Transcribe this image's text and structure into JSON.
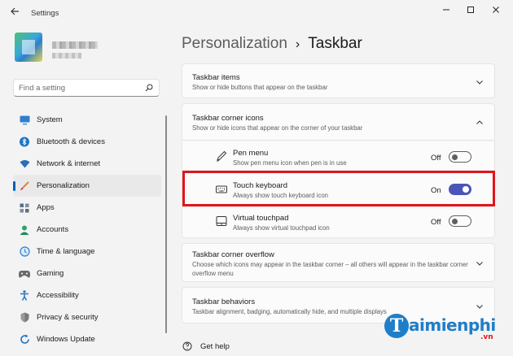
{
  "window": {
    "title": "Settings",
    "back_icon": "arrow-left-icon",
    "controls": [
      "minimize-icon",
      "maximize-icon",
      "close-icon"
    ]
  },
  "search": {
    "placeholder": "Find a setting",
    "icon": "search-icon"
  },
  "sidebar": {
    "items": [
      {
        "label": "System",
        "icon": "monitor-icon",
        "color": "#2f7fd0"
      },
      {
        "label": "Bluetooth & devices",
        "icon": "bluetooth-icon",
        "color": "#1e73c9"
      },
      {
        "label": "Network & internet",
        "icon": "wifi-icon",
        "color": "#2a6fb6"
      },
      {
        "label": "Personalization",
        "icon": "brush-icon",
        "color": "#e08a2c",
        "active": true
      },
      {
        "label": "Apps",
        "icon": "apps-icon",
        "color": "#5a6f86"
      },
      {
        "label": "Accounts",
        "icon": "person-icon",
        "color": "#2aa36b"
      },
      {
        "label": "Time & language",
        "icon": "globe-clock-icon",
        "color": "#2c7ed6"
      },
      {
        "label": "Gaming",
        "icon": "gamepad-icon",
        "color": "#6a6a6a"
      },
      {
        "label": "Accessibility",
        "icon": "accessibility-icon",
        "color": "#2b75c7"
      },
      {
        "label": "Privacy & security",
        "icon": "shield-icon",
        "color": "#7a7a7a"
      },
      {
        "label": "Windows Update",
        "icon": "update-icon",
        "color": "#1f72c4"
      }
    ]
  },
  "breadcrumb": {
    "parent": "Personalization",
    "separator": "›",
    "current": "Taskbar"
  },
  "sections": {
    "taskbar_items": {
      "title": "Taskbar items",
      "desc": "Show or hide buttons that appear on the taskbar",
      "expanded": false
    },
    "corner_icons": {
      "title": "Taskbar corner icons",
      "desc": "Show or hide icons that appear on the corner of your taskbar",
      "expanded": true,
      "items": [
        {
          "title": "Pen menu",
          "desc": "Show pen menu icon when pen is in use",
          "state": "Off",
          "icon": "pen-icon"
        },
        {
          "title": "Touch keyboard",
          "desc": "Always show touch keyboard icon",
          "state": "On",
          "icon": "keyboard-icon"
        },
        {
          "title": "Virtual touchpad",
          "desc": "Always show virtual touchpad icon",
          "state": "Off",
          "icon": "touchpad-icon"
        }
      ]
    },
    "corner_overflow": {
      "title": "Taskbar corner overflow",
      "desc": "Choose which icons may appear in the taskbar corner – all others will appear in the taskbar corner overflow menu",
      "expanded": false
    },
    "behaviors": {
      "title": "Taskbar behaviors",
      "desc": "Taskbar alignment, badging, automatically hide, and multiple displays",
      "expanded": false
    }
  },
  "help": {
    "label": "Get help",
    "icon": "help-icon"
  },
  "watermark": {
    "brand": "aimienphi",
    "initial": "T",
    "tld": ".vn",
    "color": "#1f7ec8"
  },
  "highlight_color": "#e0161b",
  "accent": "#4a55b8"
}
